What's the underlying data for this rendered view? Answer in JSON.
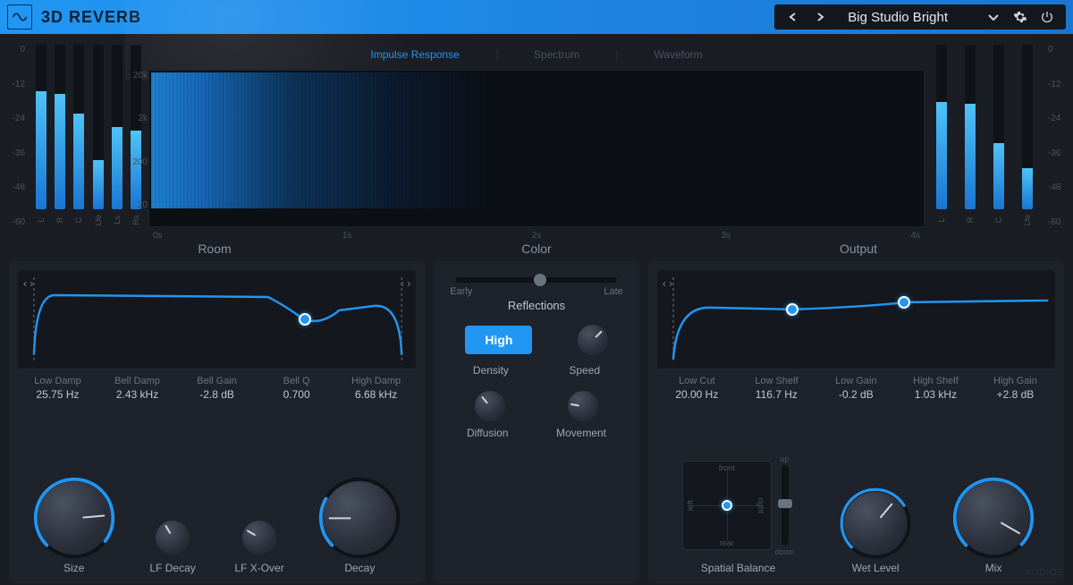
{
  "header": {
    "title": "3D REVERB",
    "preset": "Big Studio Bright"
  },
  "viz": {
    "tabs": [
      "Impulse Response",
      "Spectrum",
      "Waveform"
    ],
    "active_tab": "Impulse Response",
    "db_scale": [
      "0",
      "-12",
      "-24",
      "-36",
      "-48",
      "-60"
    ],
    "freq_scale": [
      "20k",
      "2k",
      "200",
      "20"
    ],
    "time_scale": [
      "0s",
      "1s",
      "2s",
      "3s",
      "4s"
    ],
    "meter_channels_left": [
      "L",
      "R",
      "C",
      "Lfe",
      "Ls",
      "Rs"
    ],
    "meter_channels_right": [
      "L",
      "R",
      "C",
      "Lfe"
    ],
    "meter_heights_left": [
      72,
      70,
      58,
      30,
      50,
      48
    ],
    "meter_heights_right": [
      65,
      64,
      40,
      25
    ]
  },
  "sections": {
    "room": "Room",
    "color": "Color",
    "output": "Output"
  },
  "room": {
    "params": [
      {
        "label": "Low Damp",
        "value": "25.75 Hz"
      },
      {
        "label": "Bell Damp",
        "value": "2.43 kHz"
      },
      {
        "label": "Bell Gain",
        "value": "-2.8 dB"
      },
      {
        "label": "Bell Q",
        "value": "0.700"
      },
      {
        "label": "High Damp",
        "value": "6.68 kHz"
      }
    ],
    "knobs": {
      "size": "Size",
      "lf_decay": "LF Decay",
      "lf_xover": "LF X-Over",
      "decay": "Decay"
    }
  },
  "color": {
    "slider_left": "Early",
    "slider_right": "Late",
    "reflections": "Reflections",
    "high": "High",
    "density": "Density",
    "speed": "Speed",
    "diffusion": "Diffusion",
    "movement": "Movement"
  },
  "output": {
    "params": [
      {
        "label": "Low Cut",
        "value": "20.00 Hz"
      },
      {
        "label": "Low Shelf",
        "value": "116.7 Hz"
      },
      {
        "label": "Low Gain",
        "value": "-0.2 dB"
      },
      {
        "label": "High Shelf",
        "value": "1.03 kHz"
      },
      {
        "label": "High Gain",
        "value": "+2.8 dB"
      }
    ],
    "spatial": {
      "label": "Spatial Balance",
      "front": "front",
      "rear": "rear",
      "left": "left",
      "right": "right",
      "up": "up",
      "down": "down"
    },
    "wet": "Wet Level",
    "mix": "Mix"
  },
  "watermark": "AUDIOZ"
}
